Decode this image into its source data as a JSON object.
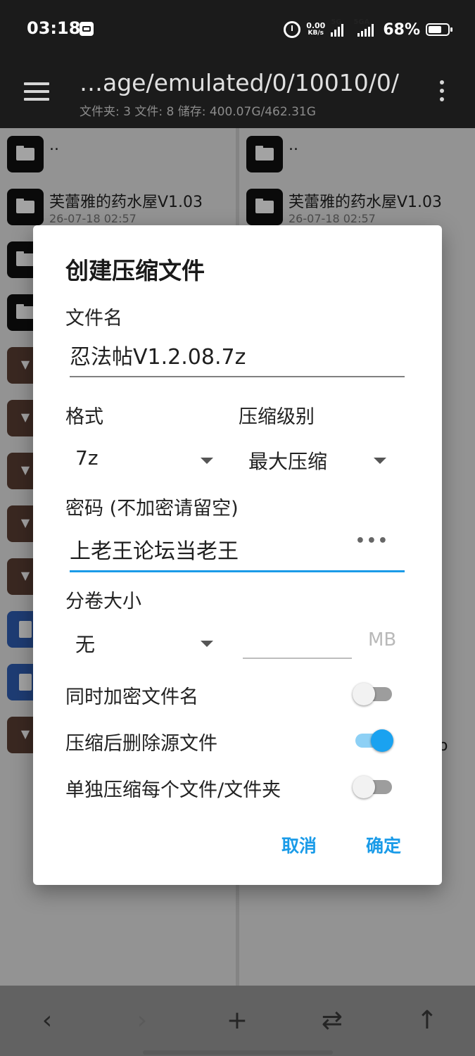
{
  "status_bar": {
    "time": "03:18",
    "net_speed_value": "0.00",
    "net_speed_unit": "KB/s",
    "signal1_label": "5G",
    "signal2_label": "5GA",
    "battery_percent": "68%",
    "battery_level": 0.68
  },
  "app_bar": {
    "path": "…age/emulated/0/10010/0/",
    "summary": "文件夹: 3  文件: 8  储存: 400.07G/462.31G"
  },
  "panes": {
    "left": {
      "rows": [
        {
          "name": "..",
          "meta": "",
          "icon": "folder-icon"
        },
        {
          "name": "芙蕾雅的药水屋V1.03",
          "meta": "26-07-18 02:57",
          "icon": "folder-icon"
        },
        {
          "name": "",
          "meta": "",
          "icon": "folder-icon"
        },
        {
          "name": "",
          "meta": "",
          "icon": "folder-icon"
        },
        {
          "name": "",
          "meta": "",
          "icon": "archive-icon"
        },
        {
          "name": "",
          "meta": "",
          "icon": "archive-icon"
        },
        {
          "name": "",
          "meta": "",
          "icon": "archive-icon"
        },
        {
          "name": "",
          "meta": "",
          "icon": "archive-icon"
        },
        {
          "name": "",
          "meta": "",
          "icon": "archive-icon"
        },
        {
          "name": "",
          "meta": "",
          "icon": "document-icon"
        },
        {
          "name": "",
          "meta": "",
          "icon": "document-icon"
        },
        {
          "name": "",
          "meta": "",
          "icon": "archive-icon"
        }
      ]
    },
    "right": {
      "rows": [
        {
          "name": "..",
          "meta": "",
          "icon": "folder-icon"
        },
        {
          "name": "芙蕾雅的药水屋V1.03",
          "meta": "26-07-18 02:57",
          "icon": "folder-icon"
        }
      ],
      "partial_text": "o"
    }
  },
  "dialog": {
    "title": "创建压缩文件",
    "filename_label": "文件名",
    "filename_value": "忍法帖V1.2.08.7z",
    "format_label": "格式",
    "format_value": "7z",
    "level_label": "压缩级别",
    "level_value": "最大压缩",
    "password_label": "密码 (不加密请留空)",
    "password_value": "上老王论坛当老王",
    "password_toggle": "•••",
    "split_label": "分卷大小",
    "split_value": "无",
    "split_size_value": "",
    "split_unit": "MB",
    "options": [
      {
        "label": "同时加密文件名",
        "on": false
      },
      {
        "label": "压缩后删除源文件",
        "on": true
      },
      {
        "label": "单独压缩每个文件/文件夹",
        "on": false
      }
    ],
    "cancel_label": "取消",
    "ok_label": "确定"
  },
  "bottom_bar": {
    "back_icon": "‹",
    "forward_icon": "›",
    "add_icon": "+",
    "swap_icon": "⇄",
    "up_icon": "↑"
  },
  "colors": {
    "accent": "#1a9be8",
    "folder_icon_bg": "#111111",
    "archive_icon_bg": "#5b3f35",
    "document_icon_bg": "#2f5fb5"
  }
}
